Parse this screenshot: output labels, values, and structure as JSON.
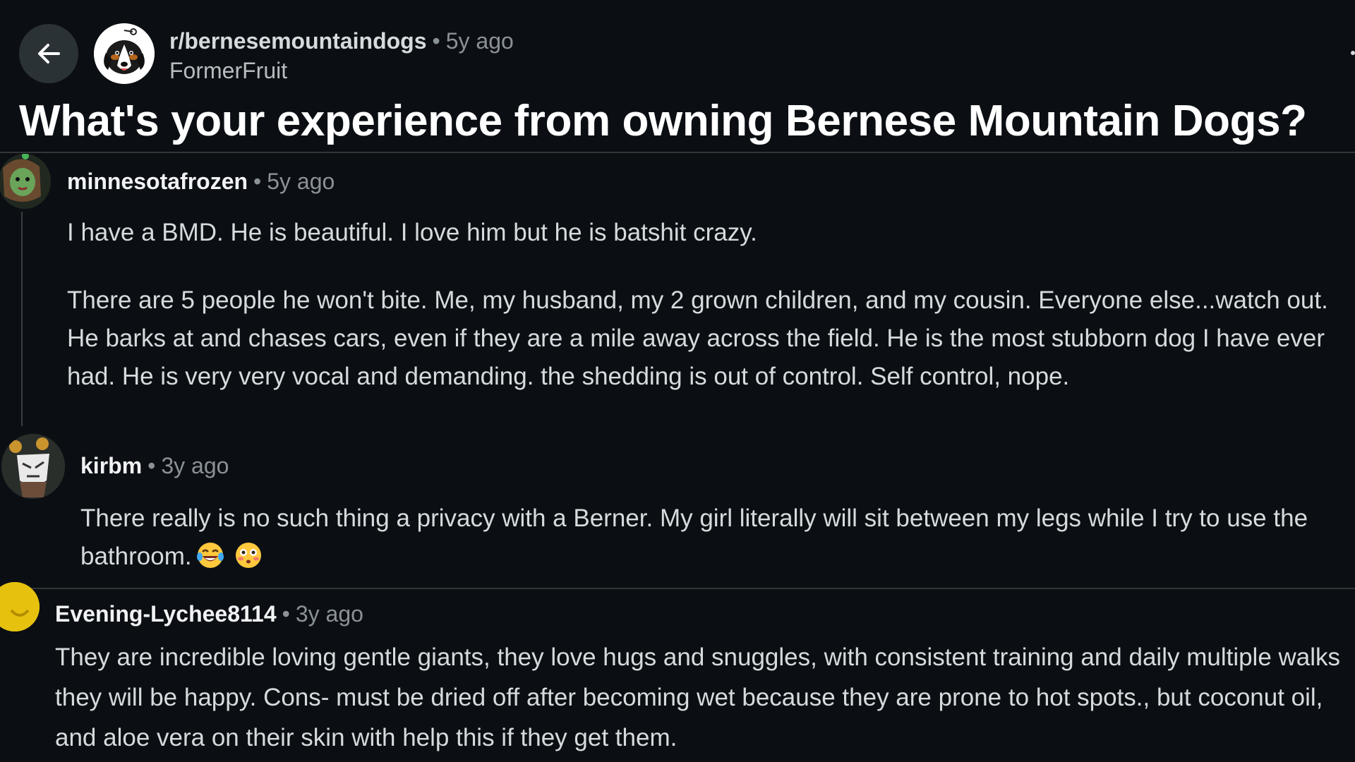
{
  "post": {
    "subreddit": "r/bernesemountaindogs",
    "age": "5y ago",
    "author": "FormerFruit",
    "title": "What's your experience from owning Bernese Mountain Dogs?",
    "separator": "•"
  },
  "icons": {
    "back": "arrow-left-icon",
    "subreddit_avatar": "bernese-dog-avatar",
    "emoji_1": "laughing-tears-emoji",
    "emoji_2": "flushed-face-emoji"
  },
  "comments": [
    {
      "username": "minnesotafrozen",
      "age": "5y ago",
      "paragraphs": [
        "I have a BMD. He is beautiful. I love him but he is batshit crazy.",
        "There are 5 people he won't bite. Me, my husband, my 2 grown children, and my cousin. Everyone else...watch out. He barks at and chases cars, even if they are a mile away across the field. He is the most stubborn dog I have ever had. He is very very vocal and demanding. the shedding is out of control. Self control, nope."
      ]
    },
    {
      "username": "kirbm",
      "age": "3y ago",
      "paragraphs": [
        "There really is no such thing a privacy with a Berner. My girl literally will sit between my legs while I try to use the bathroom."
      ]
    },
    {
      "username": "Evening-Lychee8114",
      "age": "3y ago",
      "paragraphs": [
        "They are incredible loving gentle giants, they love hugs and snuggles, with consistent training and daily multiple walks they will be happy.  Cons- must be dried off after becoming wet because they are prone to hot spots., but coconut oil,  and aloe vera on their skin with help this if they get them."
      ]
    }
  ],
  "colors": {
    "background": "#0b0f14",
    "text": "#d7dadc",
    "muted": "#8b9296",
    "divider": "#343536"
  }
}
